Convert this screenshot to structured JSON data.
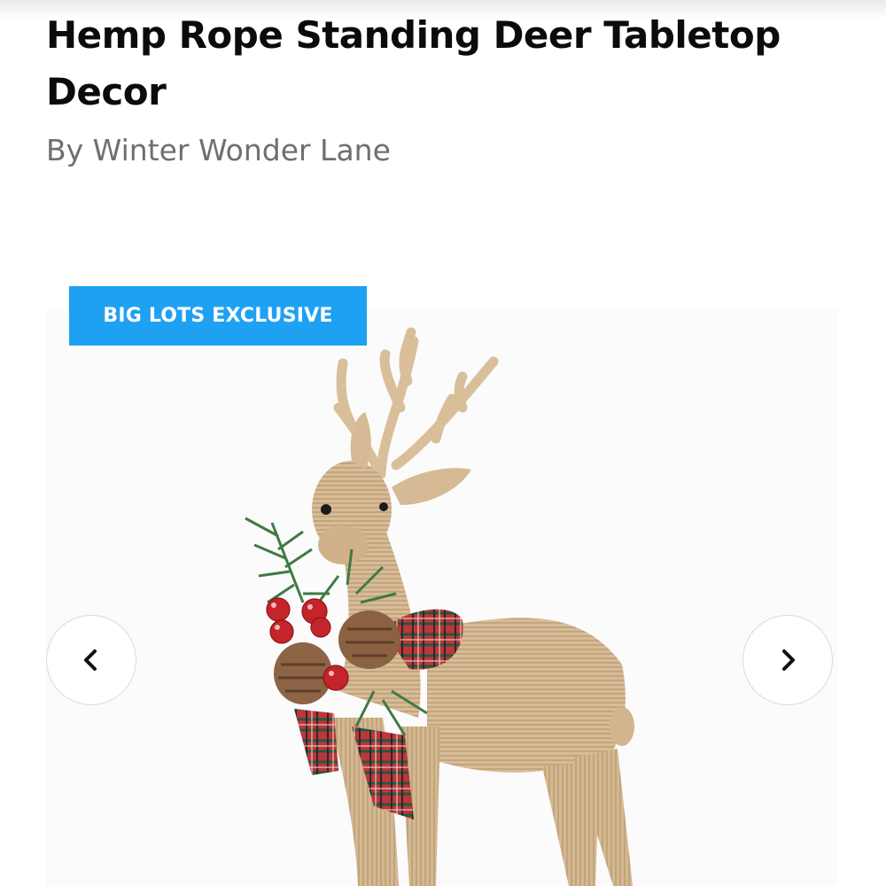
{
  "product": {
    "title": "Hemp Rope Standing Deer Tabletop Decor",
    "brand": "By Winter Wonder Lane"
  },
  "badge": {
    "label": "BIG LOTS EXCLUSIVE",
    "color": "#1ea1f2"
  },
  "carousel": {
    "prev_icon": "chevron-left-icon",
    "next_icon": "chevron-right-icon"
  },
  "image": {
    "alt": "Hemp Rope Standing Deer Tabletop Decor"
  }
}
